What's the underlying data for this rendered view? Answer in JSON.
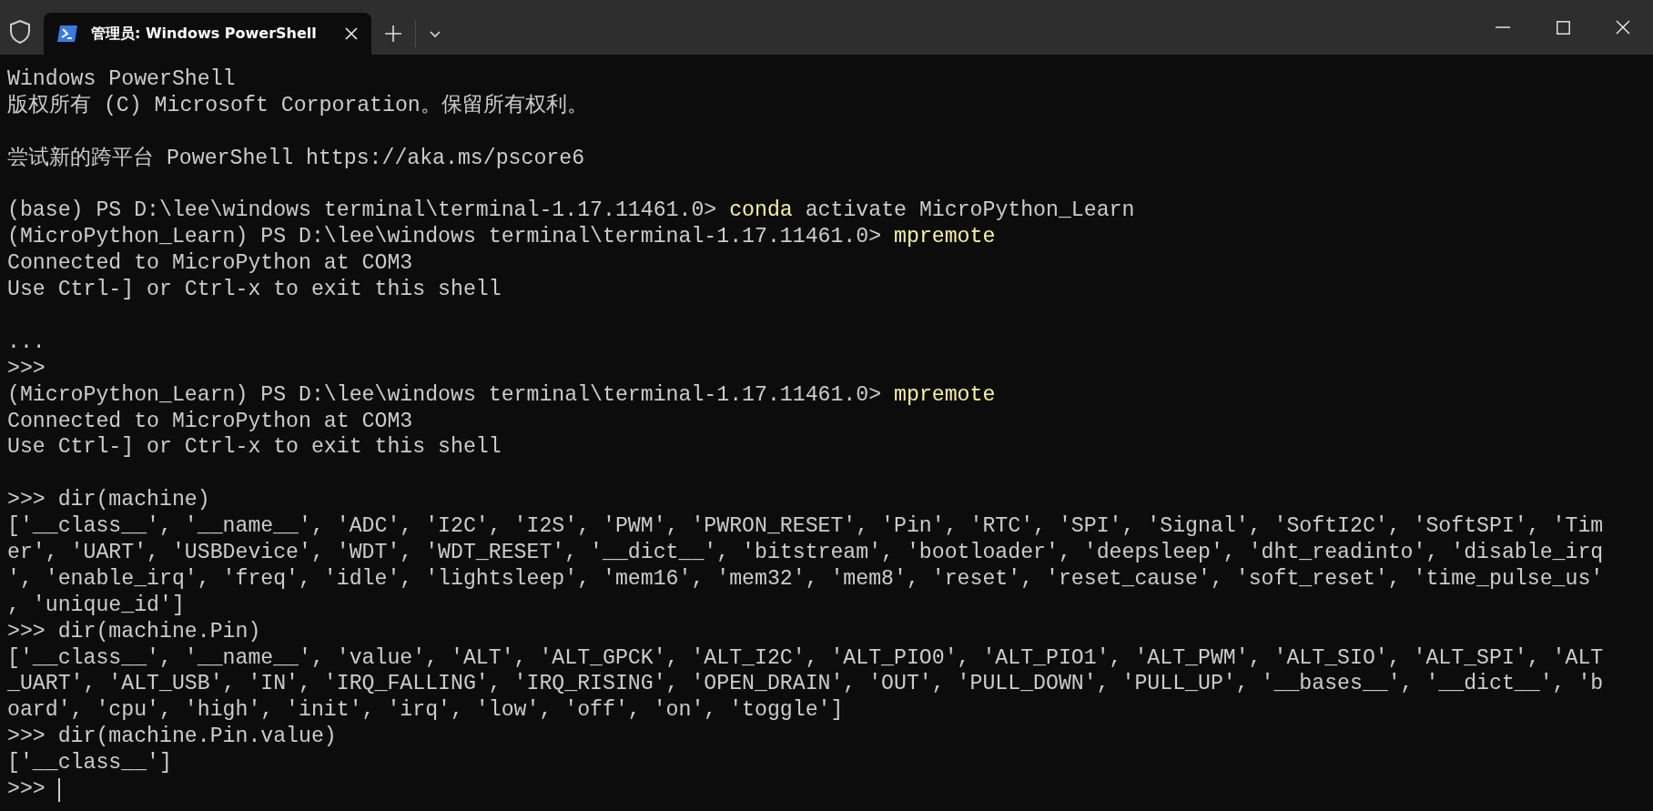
{
  "tabs": [
    {
      "title": "管理员: Windows PowerShell",
      "selected": true
    }
  ],
  "terminal": {
    "lines": [
      {
        "kind": "output",
        "text": "Windows PowerShell"
      },
      {
        "kind": "output",
        "text": "版权所有 (C) Microsoft Corporation。保留所有权利。"
      },
      {
        "kind": "blank"
      },
      {
        "kind": "output",
        "text": "尝试新的跨平台 PowerShell https://aka.ms/pscore6"
      },
      {
        "kind": "blank"
      },
      {
        "kind": "command",
        "prompt": "(base) PS D:\\lee\\windows terminal\\terminal-1.17.11461.0>",
        "program": "conda",
        "args": "activate MicroPython_Learn"
      },
      {
        "kind": "command",
        "prompt": "(MicroPython_Learn) PS D:\\lee\\windows terminal\\terminal-1.17.11461.0>",
        "program": "mpremote"
      },
      {
        "kind": "output",
        "text": "Connected to MicroPython at COM3"
      },
      {
        "kind": "output",
        "text": "Use Ctrl-] or Ctrl-x to exit this shell"
      },
      {
        "kind": "blank"
      },
      {
        "kind": "output",
        "text": "..."
      },
      {
        "kind": "output",
        "text": ">>>"
      },
      {
        "kind": "command",
        "prompt": "(MicroPython_Learn) PS D:\\lee\\windows terminal\\terminal-1.17.11461.0>",
        "program": "mpremote"
      },
      {
        "kind": "output",
        "text": "Connected to MicroPython at COM3"
      },
      {
        "kind": "output",
        "text": "Use Ctrl-] or Ctrl-x to exit this shell"
      },
      {
        "kind": "blank"
      },
      {
        "kind": "output",
        "text": ">>> dir(machine)"
      },
      {
        "kind": "output",
        "text": "['__class__', '__name__', 'ADC', 'I2C', 'I2S', 'PWM', 'PWRON_RESET', 'Pin', 'RTC', 'SPI', 'Signal', 'SoftI2C', 'SoftSPI', 'Tim"
      },
      {
        "kind": "output",
        "text": "er', 'UART', 'USBDevice', 'WDT', 'WDT_RESET', '__dict__', 'bitstream', 'bootloader', 'deepsleep', 'dht_readinto', 'disable_irq"
      },
      {
        "kind": "output",
        "text": "', 'enable_irq', 'freq', 'idle', 'lightsleep', 'mem16', 'mem32', 'mem8', 'reset', 'reset_cause', 'soft_reset', 'time_pulse_us'"
      },
      {
        "kind": "output",
        "text": ", 'unique_id']"
      },
      {
        "kind": "output",
        "text": ">>> dir(machine.Pin)"
      },
      {
        "kind": "output",
        "text": "['__class__', '__name__', 'value', 'ALT', 'ALT_GPCK', 'ALT_I2C', 'ALT_PIO0', 'ALT_PIO1', 'ALT_PWM', 'ALT_SIO', 'ALT_SPI', 'ALT"
      },
      {
        "kind": "output",
        "text": "_UART', 'ALT_USB', 'IN', 'IRQ_FALLING', 'IRQ_RISING', 'OPEN_DRAIN', 'OUT', 'PULL_DOWN', 'PULL_UP', '__bases__', '__dict__', 'b"
      },
      {
        "kind": "output",
        "text": "oard', 'cpu', 'high', 'init', 'irq', 'low', 'off', 'on', 'toggle']"
      },
      {
        "kind": "output",
        "text": ">>> dir(machine.Pin.value)"
      },
      {
        "kind": "output",
        "text": "['__class__']"
      },
      {
        "kind": "input",
        "text": ">>>"
      }
    ]
  }
}
